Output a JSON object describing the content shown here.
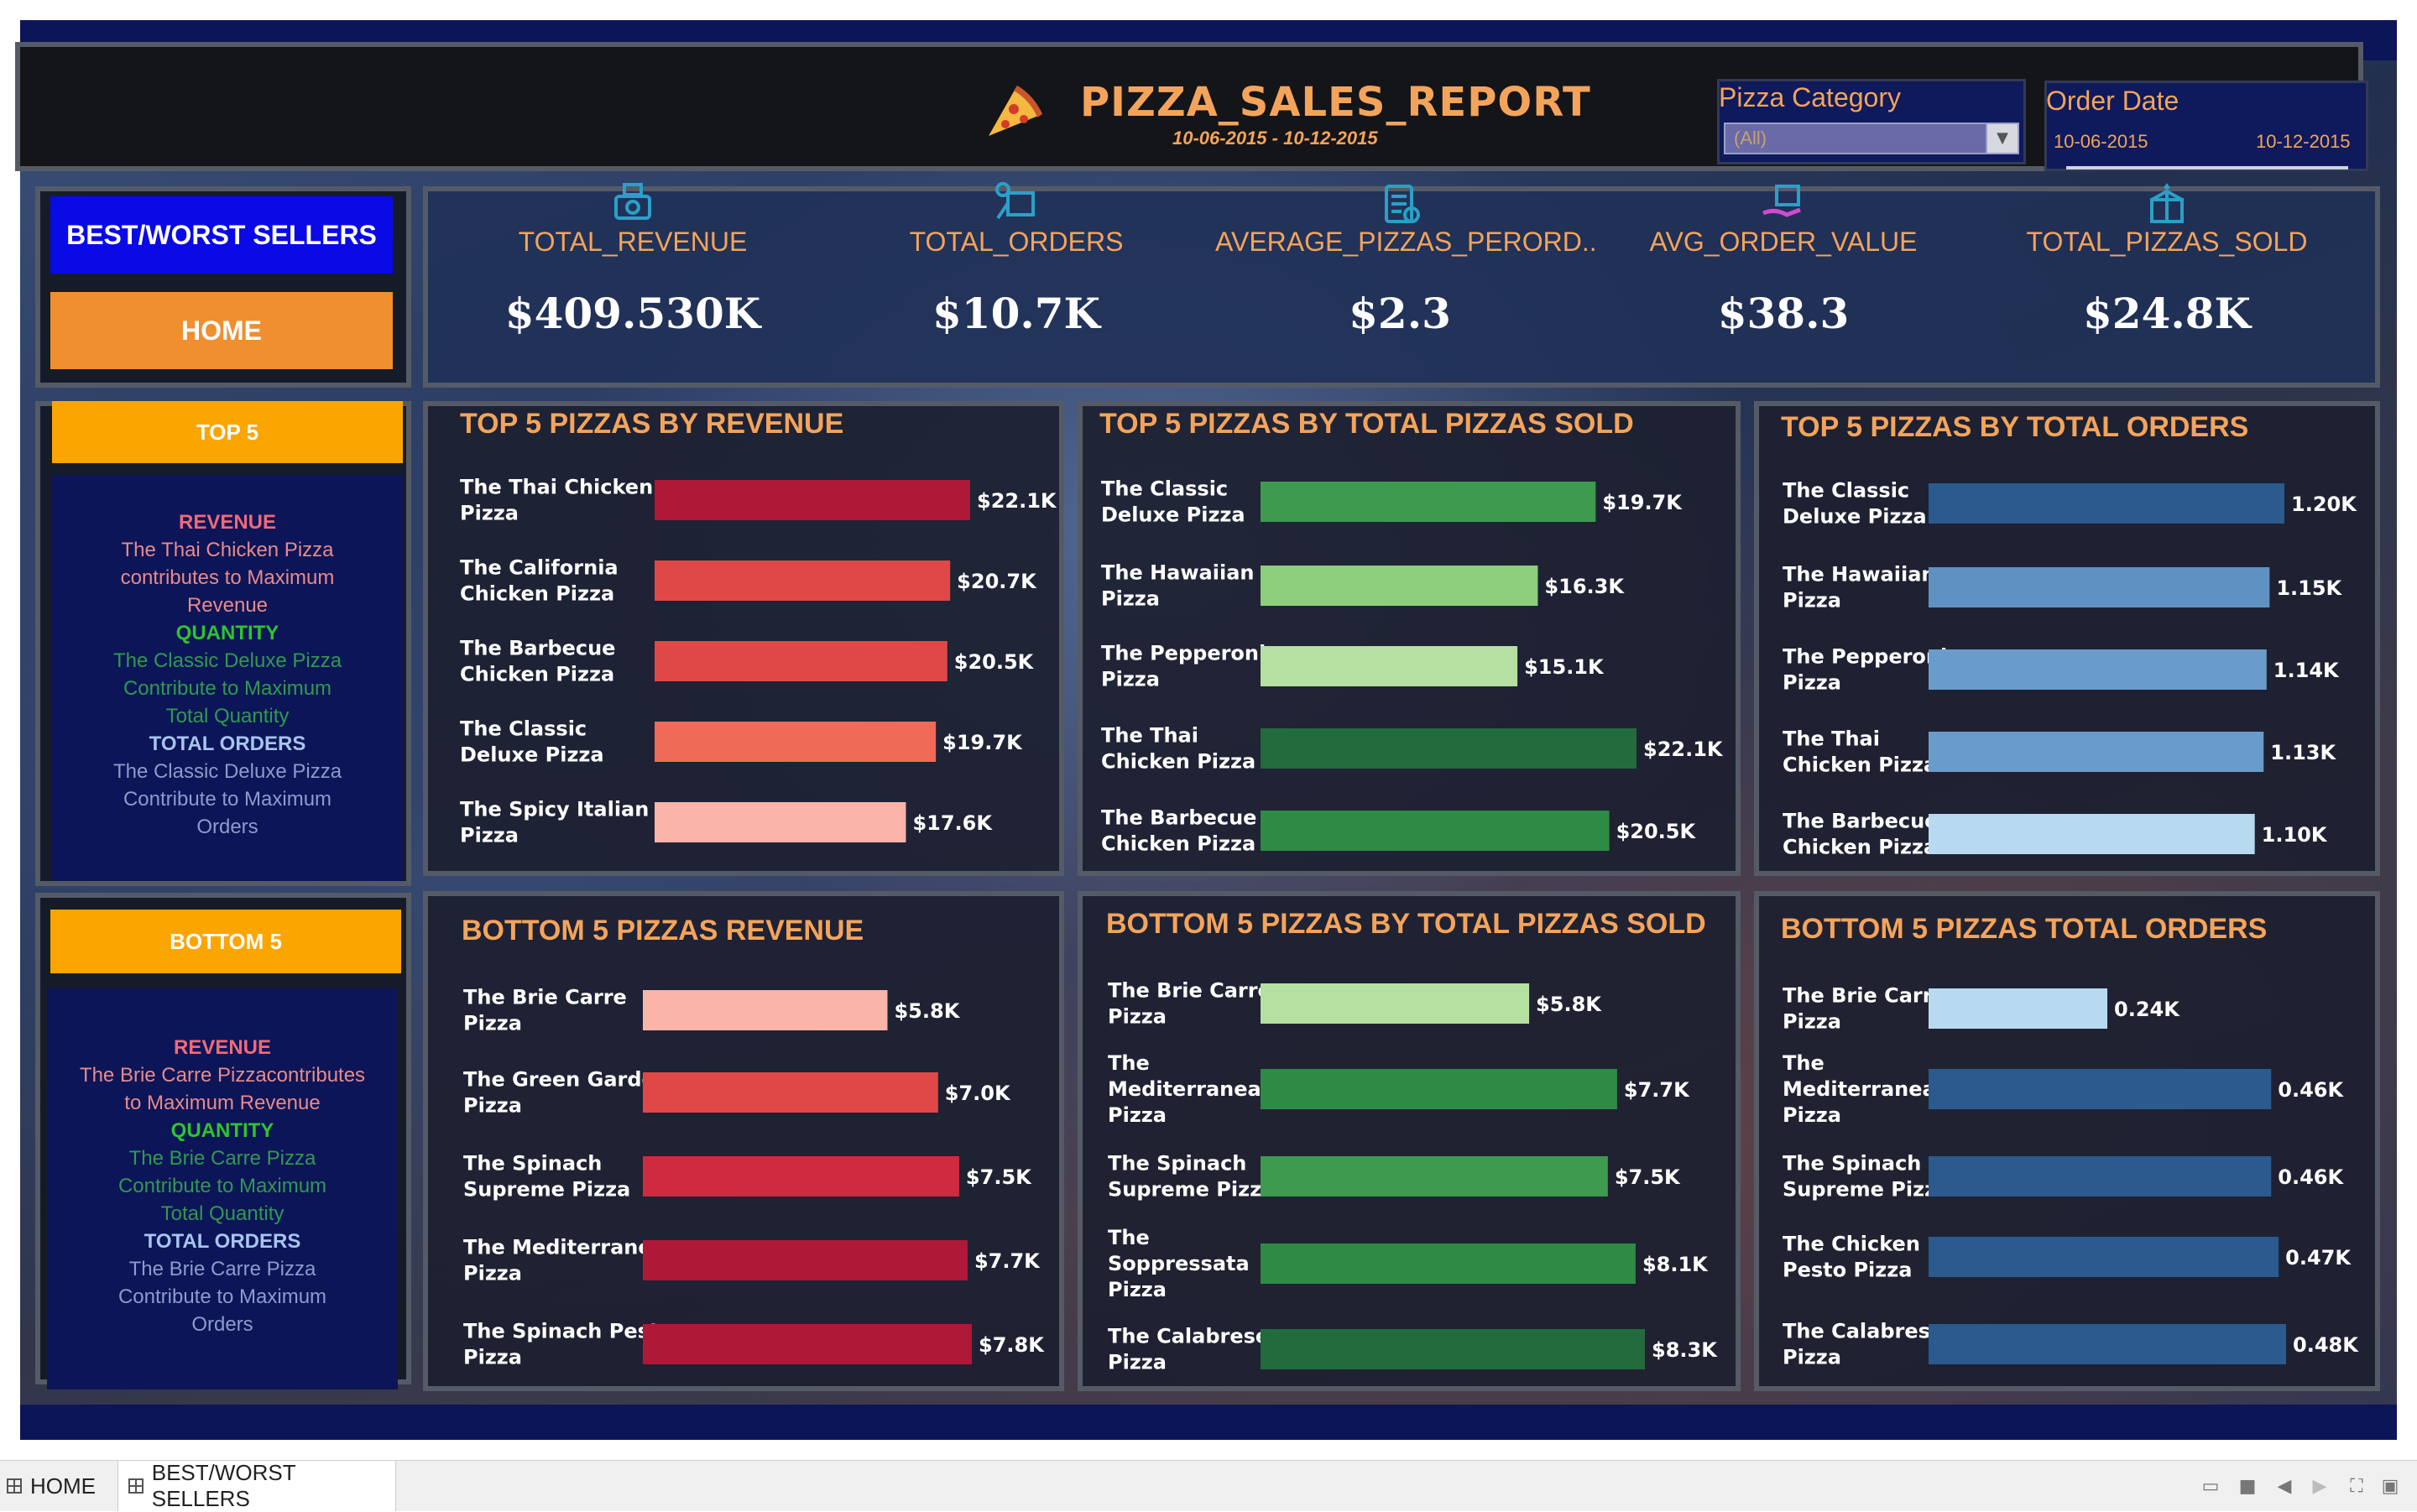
{
  "header": {
    "title": "PIZZA_SALES_REPORT",
    "date_range": "10-06-2015 - 10-12-2015",
    "pizza_category": {
      "label": "Pizza Category",
      "value": "(All)"
    },
    "order_date": {
      "label": "Order Date",
      "start": "10-06-2015",
      "end": "10-12-2015"
    }
  },
  "kpis": [
    {
      "label": "TOTAL_REVENUE",
      "value": "$409.530K",
      "icon": "money-icon"
    },
    {
      "label": "TOTAL_ORDERS",
      "value": "$10.7K",
      "icon": "delivery-icon"
    },
    {
      "label": "AVERAGE_PIZZAS_PERORD..",
      "value": "$2.3",
      "icon": "clipboard-icon"
    },
    {
      "label": "AVG_ORDER_VALUE",
      "value": "$38.3",
      "icon": "hand-box-icon"
    },
    {
      "label": "TOTAL_PIZZAS_SOLD",
      "value": "$24.8K",
      "icon": "gift-box-icon"
    }
  ],
  "nav": {
    "best_worst": "BEST/WORST SELLERS",
    "home": "HOME"
  },
  "top5_side": {
    "header": "TOP 5",
    "revenue_h": "REVENUE",
    "revenue_t": [
      "The Thai Chicken Pizza",
      "contributes to Maximum",
      "Revenue"
    ],
    "quantity_h": "QUANTITY",
    "quantity_t": [
      "The Classic Deluxe Pizza",
      "Contribute to Maximum",
      "Total Quantity"
    ],
    "orders_h": "TOTAL ORDERS",
    "orders_t": [
      "The Classic Deluxe Pizza",
      "Contribute to Maximum",
      "Orders"
    ]
  },
  "bottom5_side": {
    "header": "BOTTOM 5",
    "revenue_h": "REVENUE",
    "revenue_t": [
      "The Brie Carre Pizzacontributes",
      "to Maximum Revenue"
    ],
    "quantity_h": "QUANTITY",
    "quantity_t": [
      "The Brie Carre Pizza",
      "Contribute to Maximum",
      "Total Quantity"
    ],
    "orders_h": "TOTAL ORDERS",
    "orders_t": [
      "The Brie Carre Pizza",
      "Contribute to Maximum",
      "Orders"
    ]
  },
  "colors": {
    "red_dark": "#b01838",
    "red": "#e04848",
    "red_mid": "#f06a58",
    "red_light": "#fbb4a8",
    "green_dark": "#236b3c",
    "green": "#3e9a4f",
    "green_light": "#8dce7c",
    "green_pale": "#b5e0a2",
    "blue_dark": "#2a5a8e",
    "blue": "#5f92c2",
    "blue_light": "#b8daf0",
    "accent": "#f4a45a"
  },
  "chart_data": [
    {
      "type": "bar",
      "title": "TOP 5 PIZZAS BY REVENUE",
      "categories": [
        "The Thai Chicken Pizza",
        "The California Chicken Pizza",
        "The Barbecue Chicken Pizza",
        "The Classic Deluxe Pizza",
        "The Spicy Italian Pizza"
      ],
      "values": [
        22.1,
        20.7,
        20.5,
        19.7,
        17.6
      ],
      "labels": [
        "$22.1K",
        "$20.7K",
        "$20.5K",
        "$19.7K",
        "$17.6K"
      ],
      "colors": [
        "#b01838",
        "#e04848",
        "#e04848",
        "#f06a58",
        "#fbb4a8"
      ]
    },
    {
      "type": "bar",
      "title": "TOP 5 PIZZAS BY TOTAL PIZZAS SOLD",
      "categories": [
        "The Classic Deluxe Pizza",
        "The Hawaiian Pizza",
        "The Pepperoni Pizza",
        "The Thai Chicken Pizza",
        "The Barbecue Chicken Pizza"
      ],
      "values": [
        19.7,
        16.3,
        15.1,
        22.1,
        20.5
      ],
      "labels": [
        "$19.7K",
        "$16.3K",
        "$15.1K",
        "$22.1K",
        "$20.5K"
      ],
      "colors": [
        "#3e9a4f",
        "#8dce7c",
        "#b5e0a2",
        "#236b3c",
        "#2f8a45"
      ]
    },
    {
      "type": "bar",
      "title": "TOP 5 PIZZAS BY TOTAL ORDERS",
      "categories": [
        "The Classic Deluxe Pizza",
        "The Hawaiian Pizza",
        "The Pepperoni Pizza",
        "The Thai Chicken Pizza",
        "The Barbecue Chicken Pizza"
      ],
      "values": [
        1.2,
        1.15,
        1.14,
        1.13,
        1.1
      ],
      "labels": [
        "1.20K",
        "1.15K",
        "1.14K",
        "1.13K",
        "1.10K"
      ],
      "colors": [
        "#2a5a8e",
        "#5f92c2",
        "#6a9ccb",
        "#6a9ccb",
        "#b8daf0"
      ]
    },
    {
      "type": "bar",
      "title": "BOTTOM 5 PIZZAS REVENUE",
      "categories": [
        "The Brie Carre Pizza",
        "The Green Garden Pizza",
        "The Spinach Supreme Pizza",
        "The Mediterranean Pizza",
        "The Spinach Pesto Pizza"
      ],
      "values": [
        5.8,
        7.0,
        7.5,
        7.7,
        7.8
      ],
      "labels": [
        "$5.8K",
        "$7.0K",
        "$7.5K",
        "$7.7K",
        "$7.8K"
      ],
      "colors": [
        "#fbb4a8",
        "#e04848",
        "#d02a40",
        "#b01838",
        "#b01838"
      ]
    },
    {
      "type": "bar",
      "title": "BOTTOM 5 PIZZAS BY TOTAL PIZZAS SOLD",
      "categories": [
        "The Brie Carre Pizza",
        "The Mediterranean Pizza",
        "The Spinach Supreme Pizza",
        "The Soppressata Pizza",
        "The Calabrese Pizza"
      ],
      "values": [
        5.8,
        7.7,
        7.5,
        8.1,
        8.3
      ],
      "labels": [
        "$5.8K",
        "$7.7K",
        "$7.5K",
        "$8.1K",
        "$8.3K"
      ],
      "colors": [
        "#b5e0a2",
        "#2f8a45",
        "#3e9a4f",
        "#2f8a45",
        "#236b3c"
      ]
    },
    {
      "type": "bar",
      "title": "BOTTOM  5 PIZZAS TOTAL ORDERS",
      "categories": [
        "The Brie Carre Pizza",
        "The Mediterranean Pizza",
        "The Spinach Supreme Pizza",
        "The Chicken Pesto Pizza",
        "The Calabrese Pizza"
      ],
      "values": [
        0.24,
        0.46,
        0.46,
        0.47,
        0.48
      ],
      "labels": [
        "0.24K",
        "0.46K",
        "0.46K",
        "0.47K",
        "0.48K"
      ],
      "colors": [
        "#b8daf0",
        "#2a5a8e",
        "#2a5a8e",
        "#2a5a8e",
        "#2a5a8e"
      ]
    }
  ],
  "tabs": [
    {
      "label": "HOME"
    },
    {
      "label": "BEST/WORST SELLERS"
    }
  ]
}
